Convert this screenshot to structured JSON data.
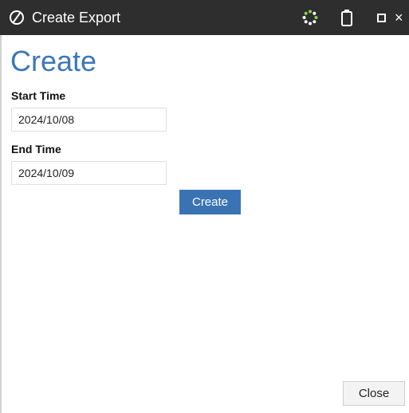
{
  "window": {
    "title": "Create Export",
    "logo_icon": "circle-slash-logo-icon",
    "busy_icon": "loading-spinner-icon",
    "clipboard_icon": "clipboard-icon",
    "maximize_icon": "maximize-icon",
    "close_icon": "close-icon",
    "close_glyph": "×"
  },
  "form": {
    "heading": "Create",
    "start_time": {
      "label": "Start Time",
      "value": "2024/10/08"
    },
    "end_time": {
      "label": "End Time",
      "value": "2024/10/09"
    },
    "submit_label": "Create"
  },
  "footer": {
    "close_label": "Close"
  },
  "colors": {
    "titlebar": "#2e2e2e",
    "heading": "#3b78b8",
    "primary_button": "#3a73b4",
    "spinner": "#8fd14f"
  }
}
